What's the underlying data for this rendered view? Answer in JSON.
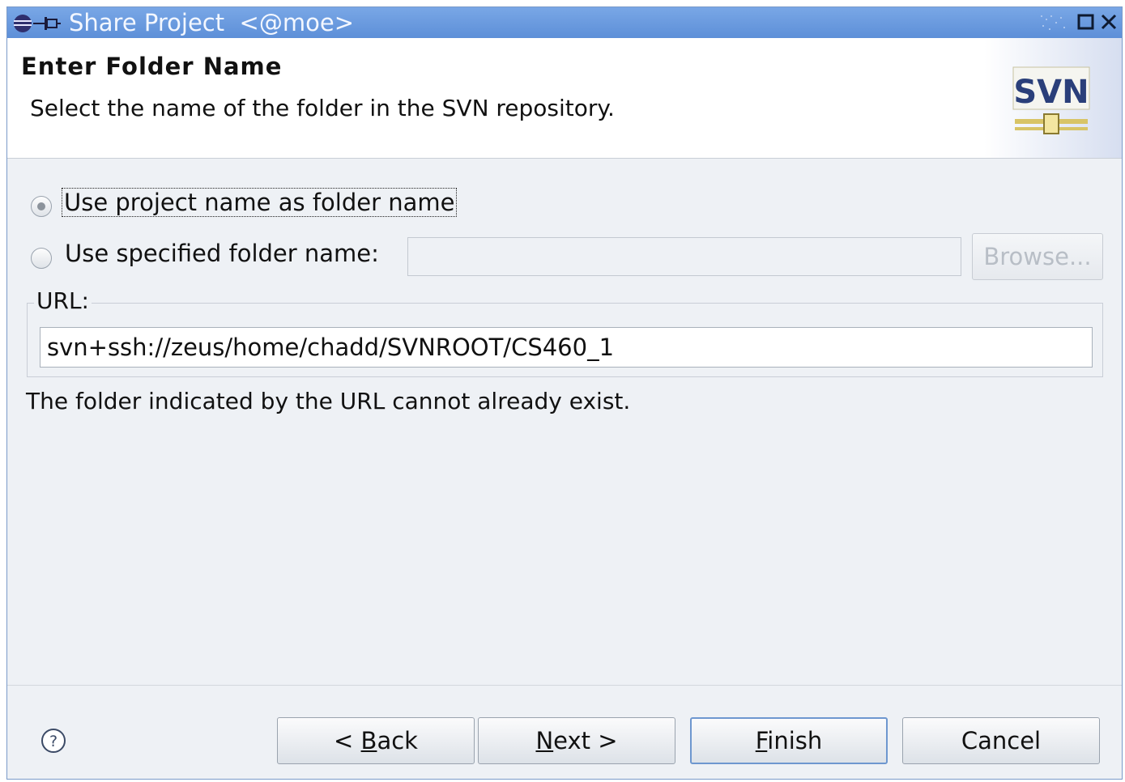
{
  "window": {
    "title": "Share Project  <@moe>",
    "title_bar_color": "#6b9be0"
  },
  "header": {
    "title": "Enter Folder Name",
    "description": "Select the name of the folder in the SVN repository.",
    "logo_text": "SVN"
  },
  "options": {
    "use_project_name_label": "Use project name as folder name",
    "use_project_name_selected": true,
    "use_specified_label": "Use specified folder name:",
    "use_specified_selected": false,
    "specified_value": "",
    "browse_label": "Browse..."
  },
  "url": {
    "legend": "URL:",
    "value": "svn+ssh://zeus/home/chadd/SVNROOT/CS460_1"
  },
  "hint": "The folder indicated by the URL cannot already exist.",
  "buttons": {
    "back": {
      "pre": "< ",
      "mnemonic": "B",
      "post": "ack"
    },
    "next": {
      "pre": "",
      "mnemonic": "N",
      "post": "ext >"
    },
    "finish": {
      "pre": "",
      "mnemonic": "F",
      "post": "inish"
    },
    "cancel": "Cancel"
  },
  "icons": [
    "eclipse-icon",
    "pin-icon",
    "maximize-icon",
    "close-icon",
    "svn-logo",
    "help-icon"
  ]
}
